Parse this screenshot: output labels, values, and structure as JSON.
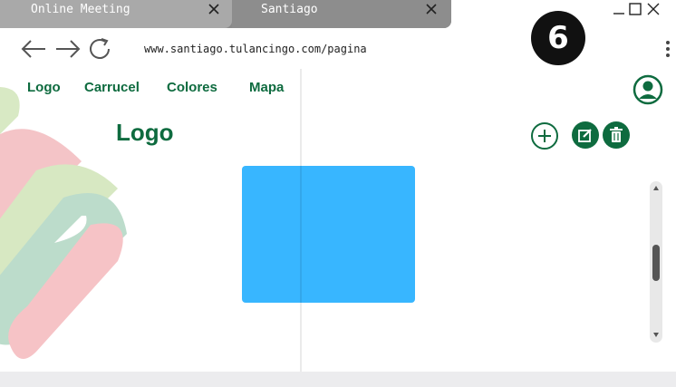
{
  "tabs": [
    {
      "label": "Online Meeting"
    },
    {
      "label": "Santiago"
    }
  ],
  "badge": "6",
  "address": {
    "url": "www.santiago.tulancingo.com/pagina"
  },
  "site_nav": [
    "Logo",
    "Carrucel",
    "Colores",
    "Mapa"
  ],
  "page": {
    "title": "Logo"
  },
  "colors": {
    "accent": "#0e6b3f",
    "preview": "#38b6ff"
  },
  "icons": [
    "back-arrow-icon",
    "forward-arrow-icon",
    "reload-icon",
    "close-icon",
    "minimize-icon",
    "maximize-icon",
    "kebab-menu-icon",
    "user-icon",
    "add-circle-icon",
    "edit-icon",
    "trash-icon"
  ]
}
